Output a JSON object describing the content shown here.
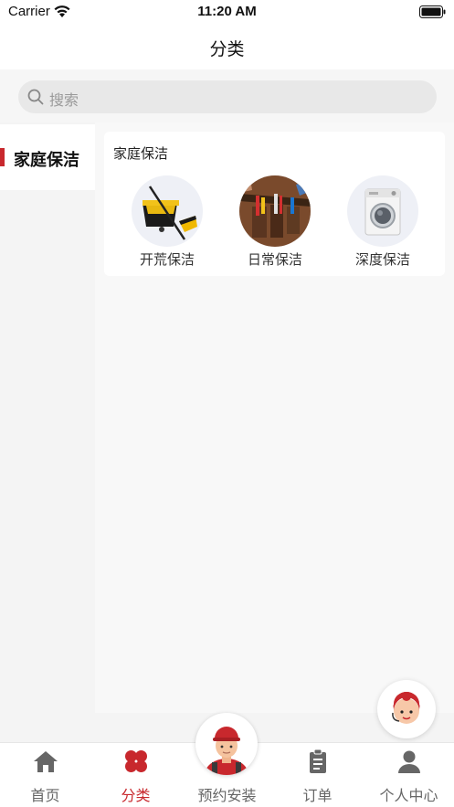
{
  "status_bar": {
    "carrier": "Carrier",
    "time": "11:20 AM"
  },
  "nav": {
    "title": "分类"
  },
  "search": {
    "placeholder": "搜索"
  },
  "sidebar": {
    "items": [
      {
        "label": "家庭保洁",
        "active": true
      }
    ]
  },
  "content": {
    "section_title": "家庭保洁",
    "categories": [
      {
        "label": "开荒保洁",
        "icon": "mop-bucket-image"
      },
      {
        "label": "日常保洁",
        "icon": "tool-belt-image"
      },
      {
        "label": "深度保洁",
        "icon": "washing-machine-image"
      }
    ]
  },
  "tabbar": {
    "items": [
      {
        "label": "首页",
        "icon": "home-icon",
        "active": false
      },
      {
        "label": "分类",
        "icon": "category-icon",
        "active": true
      },
      {
        "label": "预约安装",
        "icon": "worker-avatar",
        "active": false
      },
      {
        "label": "订单",
        "icon": "order-icon",
        "active": false
      },
      {
        "label": "个人中心",
        "icon": "person-icon",
        "active": false
      }
    ]
  },
  "colors": {
    "accent": "#c8282d",
    "inactive": "#666666",
    "background": "#f4f4f4"
  }
}
